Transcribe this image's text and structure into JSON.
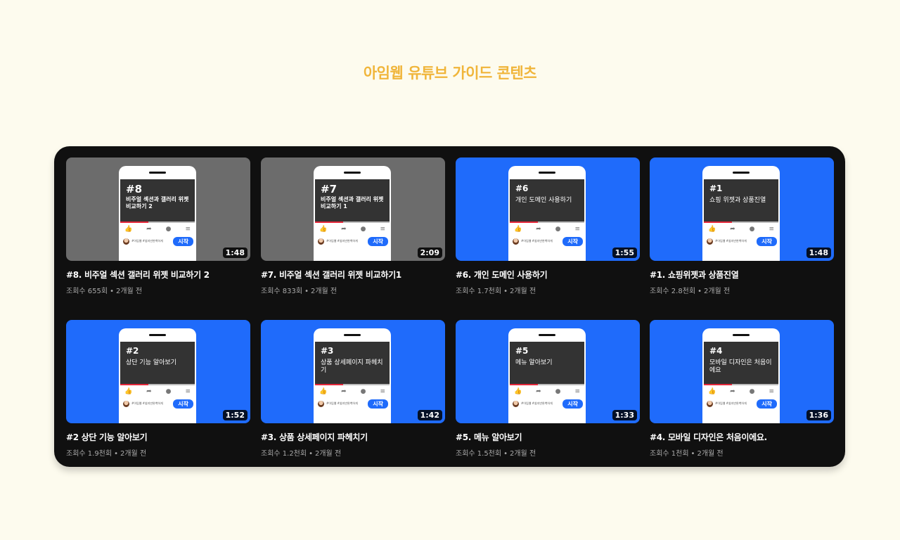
{
  "page": {
    "title": "아임웹 유튜브 가이드 콘텐츠"
  },
  "phone_ui": {
    "channel_tags": "#아임웹 #쉽지만완벽하게",
    "start_label": "시작",
    "icons": [
      "thumbs-up-icon",
      "share-icon",
      "download-icon",
      "save-icon"
    ]
  },
  "videos": [
    {
      "title": "#8. 비주얼 섹션 갤러리 위젯 비교하기 2",
      "views": "조회수 655회",
      "age": "2개월 전",
      "duration": "1:48",
      "thumb_num": "#8",
      "thumb_text": "비주얼 섹션과 갤러리 위젯 비교하기 2",
      "thumb_color": "#6c6c6c"
    },
    {
      "title": "#7. 비주얼 섹션 갤러리 위젯 비교하기1",
      "views": "조회수 833회",
      "age": "2개월 전",
      "duration": "2:09",
      "thumb_num": "#7",
      "thumb_text": "비주얼 섹션과 갤러리 위젯 비교하기 1",
      "thumb_color": "#6c6c6c"
    },
    {
      "title": "#6. 개인 도메인 사용하기",
      "views": "조회수 1.7천회",
      "age": "2개월 전",
      "duration": "1:55",
      "thumb_num": "#6",
      "thumb_text": "개인 도메인 사용하기",
      "thumb_color": "#1f6bfb"
    },
    {
      "title": "#1. 쇼핑위젯과 상품진열",
      "views": "조회수 2.8천회",
      "age": "2개월 전",
      "duration": "1:48",
      "thumb_num": "#1",
      "thumb_text": "쇼핑 위젯과 상품진열",
      "thumb_color": "#1f6bfb"
    },
    {
      "title": "#2 상단 기능 알아보기",
      "views": "조회수 1.9천회",
      "age": "2개월 전",
      "duration": "1:52",
      "thumb_num": "#2",
      "thumb_text": "상단 기능 알아보기",
      "thumb_color": "#1f6bfb"
    },
    {
      "title": "#3. 상품 상세페이지 파헤치기",
      "views": "조회수 1.2천회",
      "age": "2개월 전",
      "duration": "1:42",
      "thumb_num": "#3",
      "thumb_text": "상품 상세페이지 파헤치기",
      "thumb_color": "#1f6bfb"
    },
    {
      "title": "#5. 메뉴 알아보기",
      "views": "조회수 1.5천회",
      "age": "2개월 전",
      "duration": "1:33",
      "thumb_num": "#5",
      "thumb_text": "메뉴 알아보기",
      "thumb_color": "#1f6bfb"
    },
    {
      "title": "#4. 모바일 디자인은 처음이에요.",
      "views": "조회수 1천회",
      "age": "2개월 전",
      "duration": "1:36",
      "thumb_num": "#4",
      "thumb_text": "모바일 디자인은 처음이에요",
      "thumb_color": "#1f6bfb"
    }
  ]
}
